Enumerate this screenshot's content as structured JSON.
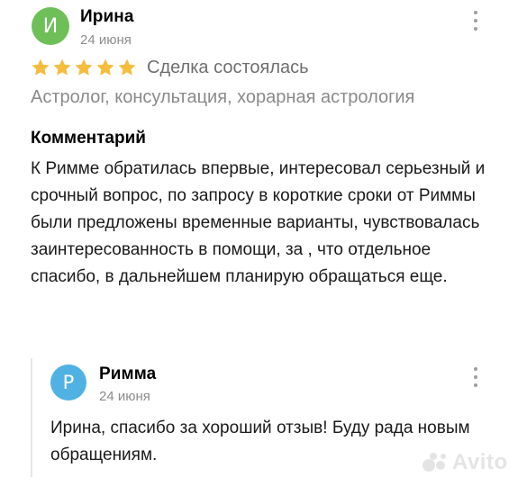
{
  "review": {
    "author_initial": "И",
    "author_name": "Ирина",
    "date": "24 июня",
    "avatar_color": "#6fbf59",
    "rating": 5,
    "star_color": "#f5bd3e",
    "deal_status": "Сделка состоялась",
    "service": "Астролог, консультация, хорарная астрология",
    "comment_heading": "Комментарий",
    "comment_text": "К Римме обратилась впервые, интересовал серьезный и срочный вопрос, по запросу в короткие сроки от Риммы были предложены временные варианты, чувствовалась заинтересованность в помощи, за , что отдельное спасибо, в дальнейшем планирую обращаться еще."
  },
  "reply": {
    "author_initial": "Р",
    "author_name": "Римма",
    "date": "24 июня",
    "avatar_color": "#4fb2e3",
    "text": "Ирина, спасибо за хороший отзыв! Буду рада новым обращениям."
  },
  "watermark": {
    "text": "Avito"
  }
}
